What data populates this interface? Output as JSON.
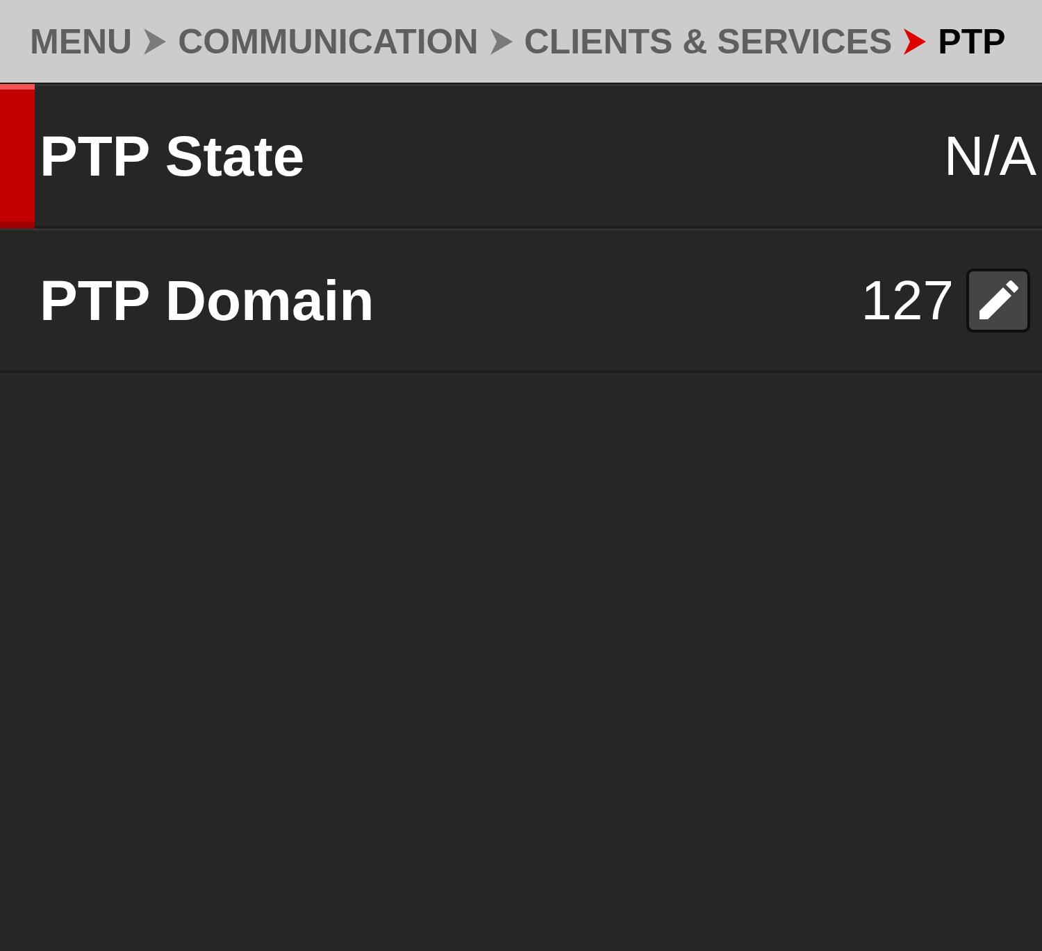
{
  "breadcrumb": [
    {
      "label": "MENU",
      "current": false
    },
    {
      "label": "COMMUNICATION",
      "current": false
    },
    {
      "label": "CLIENTS & SERVICES",
      "current": false
    },
    {
      "label": "PTP",
      "current": true
    }
  ],
  "rows": [
    {
      "label": "PTP State",
      "value": "N/A",
      "kind": "status",
      "selected": true
    },
    {
      "label": "PTP Domain",
      "value": "127",
      "kind": "editable",
      "selected": false
    }
  ]
}
